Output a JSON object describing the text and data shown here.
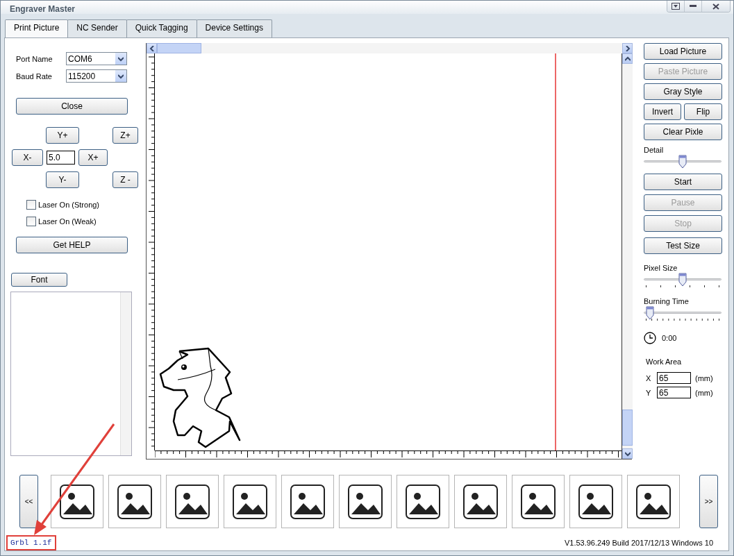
{
  "window": {
    "title": "Engraver Master"
  },
  "tabs": [
    {
      "label": "Print Picture",
      "selected": true
    },
    {
      "label": "NC Sender",
      "selected": false
    },
    {
      "label": "Quick Tagging",
      "selected": false
    },
    {
      "label": "Device Settings",
      "selected": false
    }
  ],
  "connection": {
    "port": {
      "label": "Port Name",
      "value": "COM6"
    },
    "baud": {
      "label": "Baud Rate",
      "value": "115200"
    },
    "close_button": "Close"
  },
  "jog": {
    "y_plus": "Y+",
    "z_plus": "Z+",
    "x_minus": "X-",
    "step": "5.0",
    "x_plus": "X+",
    "y_minus": "Y-",
    "z_minus": "Z -"
  },
  "lasers": [
    {
      "label": "Laser On (Strong)",
      "checked": false
    },
    {
      "label": "Laser On (Weak)",
      "checked": false
    }
  ],
  "help_button": "Get HELP",
  "font_button": "Font",
  "right_panel": {
    "controls": [
      {
        "kind": "button",
        "label": "Load Picture",
        "disabled": false
      },
      {
        "kind": "button",
        "label": "Paste Picture",
        "disabled": true
      },
      {
        "kind": "button",
        "label": "Gray Style",
        "disabled": false
      },
      {
        "kind": "pair",
        "buttons": [
          {
            "label": "Invert",
            "disabled": false
          },
          {
            "label": "Flip",
            "disabled": false
          }
        ]
      },
      {
        "kind": "button",
        "label": "Clear Pixle",
        "disabled": false
      },
      {
        "kind": "slider",
        "label": "Detail",
        "level": 0.5
      },
      {
        "kind": "button",
        "label": "Start",
        "disabled": false
      },
      {
        "kind": "button",
        "label": "Pause",
        "disabled": true
      },
      {
        "kind": "button",
        "label": "Stop",
        "disabled": true
      },
      {
        "kind": "button",
        "label": "Test Size",
        "disabled": false
      },
      {
        "kind": "ticked_slider",
        "label": "Pixel Size",
        "level": 0.5
      },
      {
        "kind": "ticked_slider",
        "label": "Burning Time",
        "level": 0.08
      },
      {
        "kind": "timer",
        "value": "0:00"
      }
    ],
    "work_area": {
      "label": "Work Area",
      "fields": [
        {
          "label": "X",
          "value": "65",
          "unit": "(mm)"
        },
        {
          "label": "Y",
          "value": "65",
          "unit": "(mm)"
        }
      ]
    }
  },
  "gallery": {
    "prev": "<<",
    "next": ">>"
  },
  "status": {
    "firmware": "Grbl 1.1f",
    "version": "V1.53.96.249 Build 2017/12/13 Windows 10"
  }
}
